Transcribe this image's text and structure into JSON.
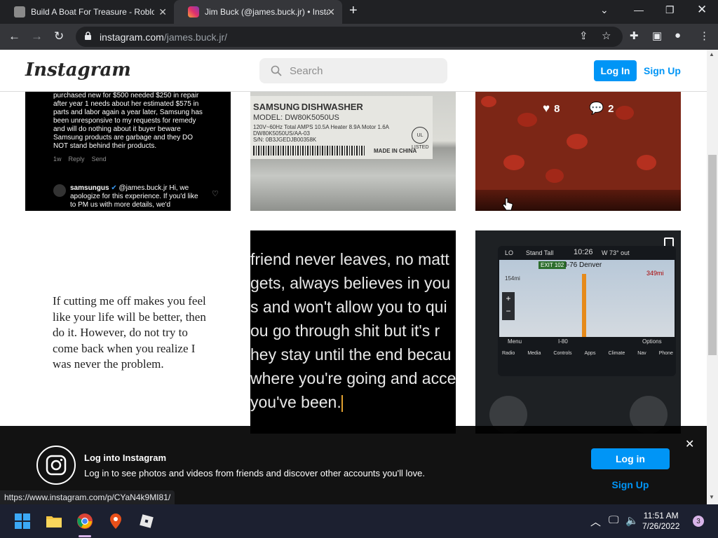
{
  "browser": {
    "tabs": [
      {
        "title": "Build A Boat For Treasure - Roblo",
        "active": false
      },
      {
        "title": "Jim Buck (@james.buck.jr) • Insta",
        "active": true
      }
    ],
    "url_host": "instagram.com",
    "url_path": "/james.buck.jr/",
    "status_url": "https://www.instagram.com/p/CYaN4k9MI81/"
  },
  "header": {
    "logo": "Instagram",
    "search_placeholder": "Search",
    "login_label": "Log In",
    "signup_label": "Sign Up"
  },
  "posts": {
    "p1": {
      "comment_text": "purchased new for $500 needed $250 in repair after year 1 needs about her estimated $575 in parts and labor again a year later, Samsung has been unresponsive to my requests for remedy and will do nothing about it buyer beware Samsung products are garbage and they DO NOT stand behind their products.",
      "meta_time": "1w",
      "meta_reply": "Reply",
      "meta_send": "Send",
      "reply_user": "samsungus",
      "reply_text": "@james.buck.jr Hi, we apologize for this experience. If you'd like to PM us with more details, we'd"
    },
    "p2": {
      "brand": "SAMSUNG",
      "product": "DISHWASHER",
      "model": "MODEL: DW80K5050US",
      "specs": "120V~60Hz Total AMPS 10.5A Heater 8.9A Motor 1.6A",
      "model_code": "DW80K5050US/AA-03",
      "serial": "S/N: 0B3JGEDJB00358K",
      "made_in": "MADE IN CHINA",
      "listed": "LISTED"
    },
    "p3": {
      "likes": "8",
      "comments": "2"
    },
    "p4": {
      "quote": "If cutting me off makes you feel like your life will be better, then do it. However, do not try to come back when you realize I was never the problem."
    },
    "p5": {
      "lines": [
        "friend never leaves, no matt",
        "gets, always believes in you",
        "s and won't allow you to qui",
        "ou go through shit but it's r",
        "hey stay until the end becau",
        "where you're going and acce",
        "you've been."
      ]
    },
    "p6": {
      "stand": "Stand Tall",
      "time": "10:26",
      "temp": "W  73° out",
      "exit": "EXIT 102",
      "route": "I-76 Denver",
      "lo": "LO",
      "distance": "349mi",
      "mi": "154mi",
      "road": "I-80",
      "menu": "Menu",
      "options": "Options",
      "apps": [
        "Radio",
        "Media",
        "Controls",
        "Apps",
        "Climate",
        "Nav",
        "Phone"
      ]
    }
  },
  "banner": {
    "title": "Log into Instagram",
    "text": "Log in to see photos and videos from friends and discover other accounts you'll love.",
    "login_label": "Log in",
    "signup_label": "Sign Up"
  },
  "taskbar": {
    "time": "11:51 AM",
    "date": "7/26/2022",
    "notifications": "3"
  },
  "colors": {
    "accent": "#0095f6",
    "chrome_dark": "#202124",
    "chrome_toolbar": "#35363a",
    "taskbar": "#1c2030"
  }
}
